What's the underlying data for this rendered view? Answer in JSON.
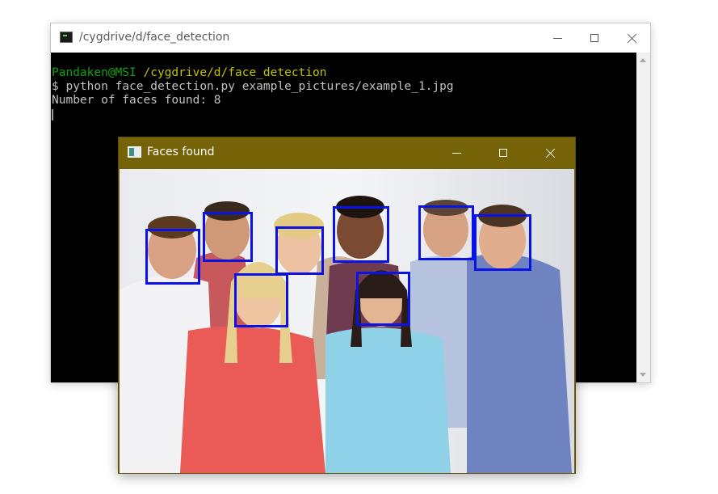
{
  "terminal": {
    "title": "/cygdrive/d/face_detection",
    "prompt_user": "Pandaken@MSI",
    "prompt_path": "/cygdrive/d/face_detection",
    "command_line": "$ python face_detection.py example_pictures/example_1.jpg",
    "output_line": "Number of faces found: 8"
  },
  "faces_window": {
    "title": "Faces found",
    "faces_detected": 8,
    "box_color": "#0a12e6"
  },
  "colors": {
    "terminal_bg": "#000000",
    "prompt_user": "#13a10e",
    "prompt_path": "#c1c100",
    "faces_titlebar": "#766308"
  },
  "icons": {
    "terminal_app": "terminal-icon",
    "faces_app": "image-window-icon",
    "minimize": "minimize-icon",
    "maximize": "maximize-icon",
    "close": "close-icon",
    "scroll_up": "scroll-up-arrow-icon",
    "scroll_down": "scroll-down-arrow-icon"
  }
}
